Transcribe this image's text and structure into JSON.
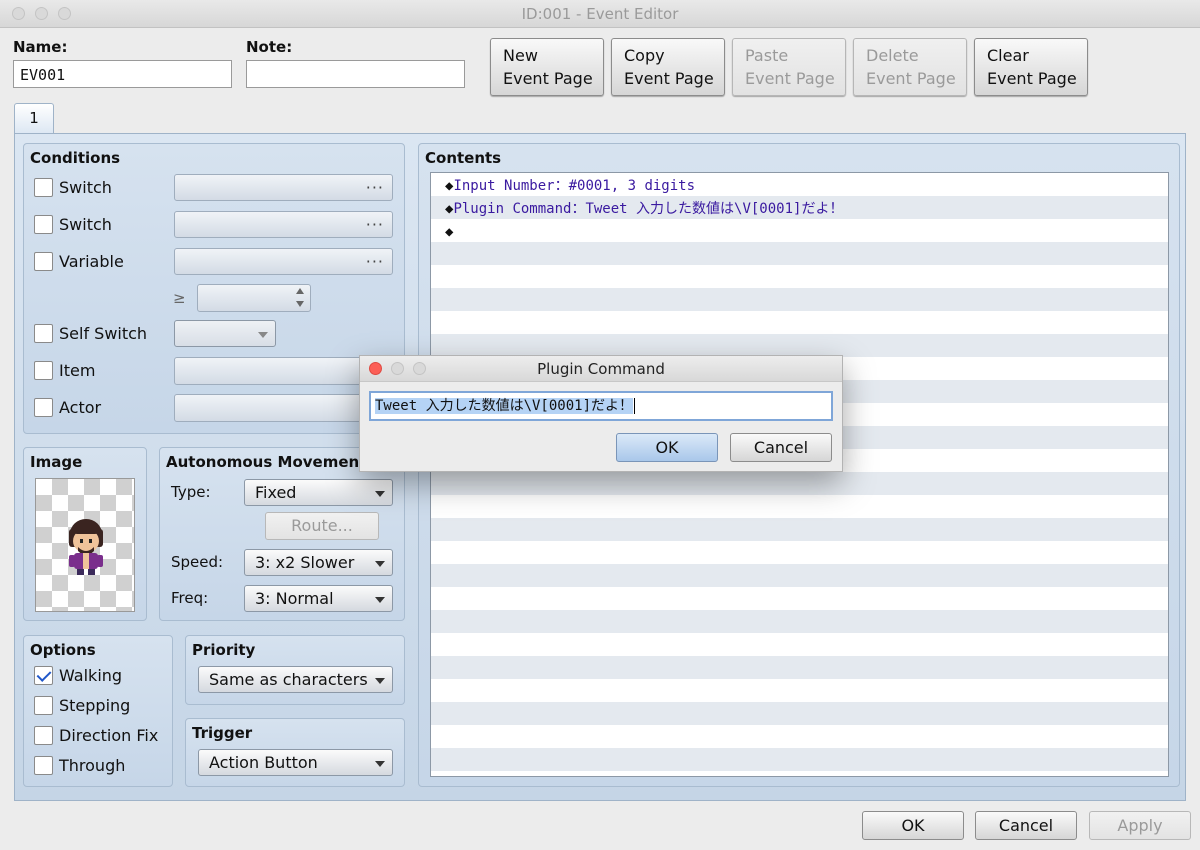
{
  "window": {
    "title": "ID:001 - Event Editor"
  },
  "name": {
    "label": "Name:",
    "value": "EV001"
  },
  "note": {
    "label": "Note:",
    "value": ""
  },
  "toolbar": {
    "new_page": "New\nEvent Page",
    "copy_page": "Copy\nEvent Page",
    "paste_page": "Paste\nEvent Page",
    "delete_page": "Delete\nEvent Page",
    "clear_page": "Clear\nEvent Page"
  },
  "tabs": [
    {
      "label": "1"
    }
  ],
  "conditions": {
    "title": "Conditions",
    "switch1": "Switch",
    "switch2": "Switch",
    "variable": "Variable",
    "compare": "≥",
    "self_switch": "Self Switch",
    "item": "Item",
    "actor": "Actor"
  },
  "image": {
    "title": "Image",
    "sprite": "character-sprite"
  },
  "movement": {
    "title": "Autonomous Movement",
    "type_label": "Type:",
    "type_value": "Fixed",
    "route_button": "Route...",
    "speed_label": "Speed:",
    "speed_value": "3: x2 Slower",
    "freq_label": "Freq:",
    "freq_value": "3: Normal"
  },
  "options": {
    "title": "Options",
    "walking": "Walking",
    "walking_checked": true,
    "stepping": "Stepping",
    "direction_fix": "Direction Fix",
    "through": "Through"
  },
  "priority": {
    "title": "Priority",
    "value": "Same as characters"
  },
  "trigger": {
    "title": "Trigger",
    "value": "Action Button"
  },
  "contents": {
    "title": "Contents",
    "lines": [
      {
        "bullet": "◆",
        "text": "Input Number：#0001, 3 digits"
      },
      {
        "bullet": "◆",
        "text": "Plugin Command：Tweet 入力した数値は\\V[0001]だよ！"
      },
      {
        "bullet": "◆",
        "text": ""
      }
    ]
  },
  "dialog": {
    "title": "Plugin Command",
    "input_value": "Tweet 入力した数値は\\V[0001]だよ！",
    "ok": "OK",
    "cancel": "Cancel"
  },
  "footer": {
    "ok": "OK",
    "cancel": "Cancel",
    "apply": "Apply"
  },
  "colors": {
    "command_text": "#3a1aa0",
    "dialog_close": "#fc5f57",
    "dialog_ok": "#c3d9f1"
  }
}
